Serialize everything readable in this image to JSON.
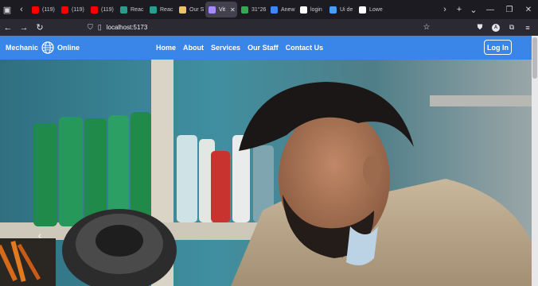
{
  "browser": {
    "tabs": [
      {
        "label": "(119)",
        "favicon": "youtube-icon",
        "color": "#ff0000",
        "active": false
      },
      {
        "label": "(119)",
        "favicon": "youtube-icon",
        "color": "#ff0000",
        "active": false
      },
      {
        "label": "(119)",
        "favicon": "youtube-icon",
        "color": "#ff0000",
        "active": false
      },
      {
        "label": "Reac",
        "favicon": "react-icon",
        "color": "#2a9d8f",
        "active": false
      },
      {
        "label": "Reac",
        "favicon": "react-icon",
        "color": "#2a9d8f",
        "active": false
      },
      {
        "label": "Our S",
        "favicon": "bolt-icon",
        "color": "#e9c46a",
        "active": false
      },
      {
        "label": "Vit",
        "favicon": "vite-icon",
        "color": "#a78bfa",
        "active": true
      },
      {
        "label": "31°26",
        "favicon": "map-pin-icon",
        "color": "#34a853",
        "active": false
      },
      {
        "label": "Anew",
        "favicon": "drive-icon",
        "color": "#4285f4",
        "active": false
      },
      {
        "label": "login",
        "favicon": "google-icon",
        "color": "#ffffff",
        "active": false
      },
      {
        "label": "Ui de",
        "favicon": "shield-icon",
        "color": "#4a9ff5",
        "active": false
      },
      {
        "label": "Lowe",
        "favicon": "google-icon",
        "color": "#ffffff",
        "active": false
      }
    ],
    "url": "localhost:5173",
    "account_initial": "A"
  },
  "page": {
    "brand_left": "Mechanic",
    "brand_right": "Online",
    "menu": [
      "Home",
      "About",
      "Services",
      "Our Staff",
      "Contact Us"
    ],
    "login_label": "Log In"
  },
  "colors": {
    "navbar": "#3a86e8",
    "tab_bg": "#1c1b22",
    "toolbar_bg": "#2b2a33"
  }
}
